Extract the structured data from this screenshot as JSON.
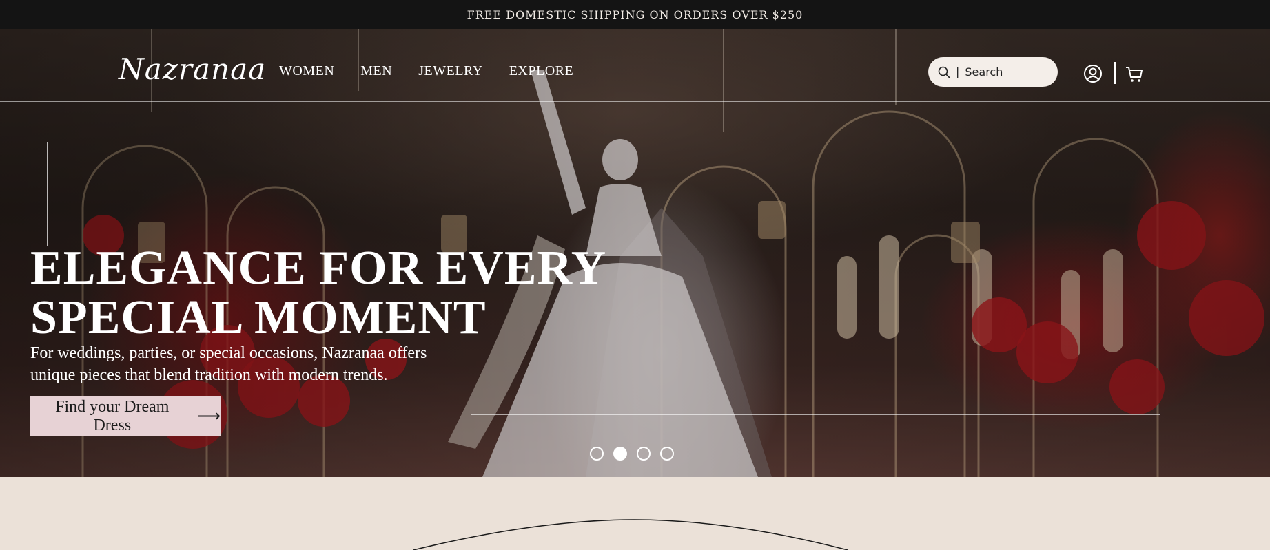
{
  "announcement": {
    "text": "FREE DOMESTIC SHIPPING ON ORDERS OVER $250"
  },
  "header": {
    "logo": "Nazranaa",
    "nav": [
      {
        "label": "WOMEN"
      },
      {
        "label": "MEN"
      },
      {
        "label": "JEWELRY"
      },
      {
        "label": "EXPLORE"
      }
    ],
    "search": {
      "placeholder": "Search",
      "caret": "|"
    },
    "icons": {
      "search": "search-icon",
      "account": "user-circle-icon",
      "cart": "cart-icon"
    }
  },
  "hero": {
    "headline_line1": "ELEGANCE FOR EVERY",
    "headline_line2": "SPECIAL MOMENT",
    "subtext_line1": "For weddings, parties, or special occasions, Nazranaa offers",
    "subtext_line2": "unique pieces that blend tradition with modern trends.",
    "cta_label": "Find your Dream Dress",
    "cta_arrow": "⟶",
    "slides_total": 4,
    "active_slide": 2
  },
  "colors": {
    "announcement_bg": "#141414",
    "cta_bg": "#e7d2d5",
    "page_bg": "#ebe1d8"
  }
}
